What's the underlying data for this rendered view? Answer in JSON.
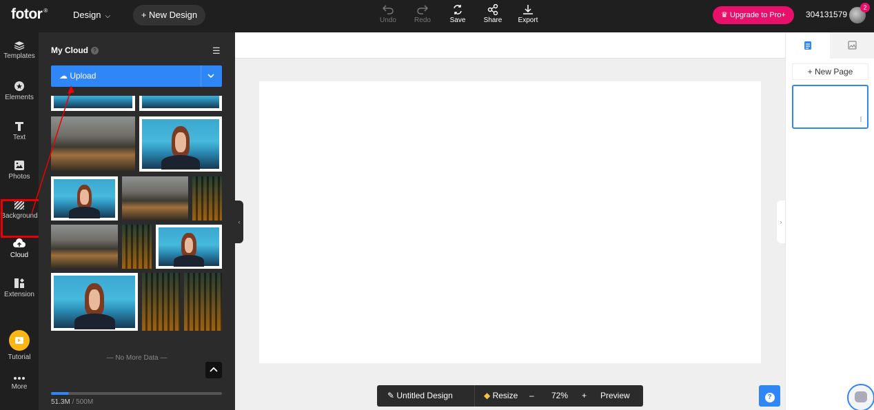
{
  "topbar": {
    "logo": "fotor",
    "logo_mark": "®",
    "design_menu": "Design",
    "new_design": "+ New Design",
    "tools": [
      {
        "label": "Undo",
        "icon": "undo-icon",
        "enabled": false
      },
      {
        "label": "Redo",
        "icon": "redo-icon",
        "enabled": false
      },
      {
        "label": "Save",
        "icon": "save-icon",
        "enabled": true
      },
      {
        "label": "Share",
        "icon": "share-icon",
        "enabled": true
      },
      {
        "label": "Export",
        "icon": "export-icon",
        "enabled": true
      }
    ],
    "upgrade": "Upgrade to Pro+",
    "user_id": "304131579",
    "notification_count": "2"
  },
  "leftnav": {
    "items": [
      {
        "label": "Templates",
        "icon": "templates-icon"
      },
      {
        "label": "Elements",
        "icon": "elements-icon"
      },
      {
        "label": "Text",
        "icon": "text-icon"
      },
      {
        "label": "Photos",
        "icon": "photos-icon"
      },
      {
        "label": "Background",
        "icon": "background-icon"
      },
      {
        "label": "Cloud",
        "icon": "cloud-upload-icon",
        "active": true
      },
      {
        "label": "Extension",
        "icon": "extension-icon"
      },
      {
        "label": "Tutorial",
        "icon": "tutorial-icon"
      },
      {
        "label": "More",
        "icon": "more-icon"
      }
    ]
  },
  "panel": {
    "title": "My Cloud",
    "help": "?",
    "upload": "Upload",
    "no_more": "— No More Data —",
    "storage_used": "51.3M",
    "storage_total": " / 500M",
    "storage_fraction": 0.103
  },
  "bottom_toolbar": {
    "design_name": "Untitled Design",
    "resize": "Resize",
    "zoom_out": "–",
    "zoom": "72%",
    "zoom_in": "+",
    "preview": "Preview"
  },
  "rightpanel": {
    "new_page": "+ New Page"
  },
  "colors": {
    "accent": "#2f86f6",
    "upgrade": "#e8106b",
    "dark": "#1f1f1f",
    "panel": "#2b2b2b"
  }
}
